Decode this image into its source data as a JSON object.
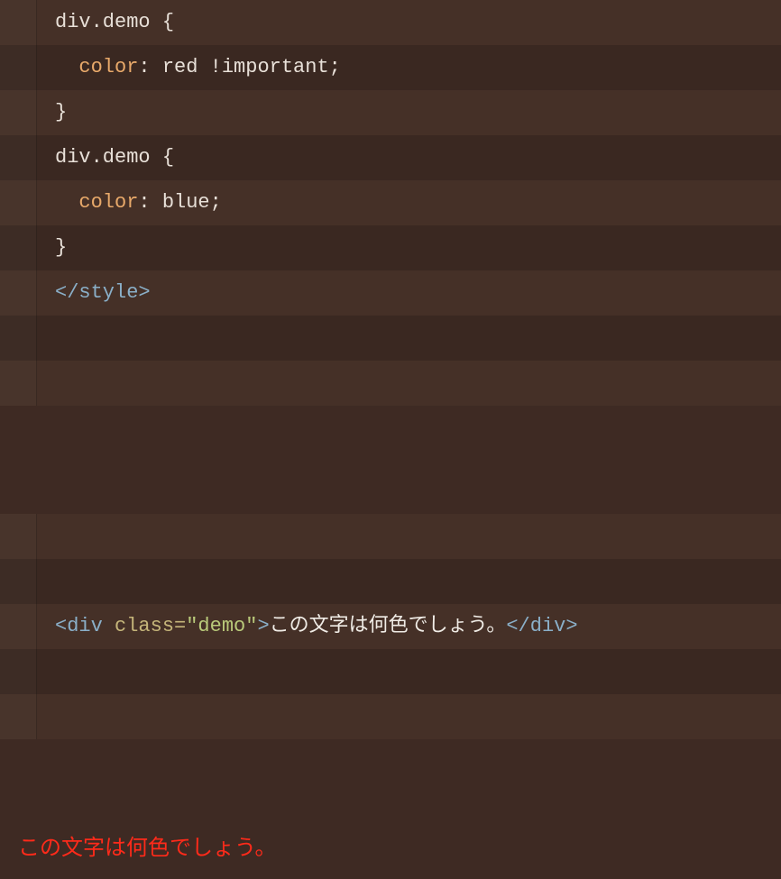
{
  "block1": {
    "lines": [
      {
        "tokens": [
          {
            "t": "div.demo {",
            "c": "tok-default"
          }
        ],
        "indent": 0
      },
      {
        "tokens": [
          {
            "t": "color",
            "c": "tok-property"
          },
          {
            "t": ": red !important;",
            "c": "tok-default"
          }
        ],
        "indent": 1
      },
      {
        "tokens": [
          {
            "t": "}",
            "c": "tok-default"
          }
        ],
        "indent": 0
      },
      {
        "tokens": [
          {
            "t": "div.demo {",
            "c": "tok-default"
          }
        ],
        "indent": 0
      },
      {
        "tokens": [
          {
            "t": "color",
            "c": "tok-property"
          },
          {
            "t": ": blue;",
            "c": "tok-default"
          }
        ],
        "indent": 1
      },
      {
        "tokens": [
          {
            "t": "}",
            "c": "tok-default"
          }
        ],
        "indent": 0
      },
      {
        "tokens": [
          {
            "t": "</style>",
            "c": "tok-tag"
          }
        ],
        "indent": 0
      },
      {
        "tokens": [],
        "indent": 0
      },
      {
        "tokens": [],
        "indent": 0
      }
    ]
  },
  "block2": {
    "lines": [
      {
        "tokens": [],
        "indent": 0
      },
      {
        "tokens": [],
        "indent": 0
      },
      {
        "tokens": [
          {
            "t": "<div ",
            "c": "tok-tag"
          },
          {
            "t": "class=",
            "c": "tok-attr"
          },
          {
            "t": "\"demo\"",
            "c": "tok-string"
          },
          {
            "t": ">",
            "c": "tok-tag"
          },
          {
            "t": "この文字は何色でしょう。",
            "c": "tok-text"
          },
          {
            "t": "</div>",
            "c": "tok-tag"
          }
        ],
        "indent": 0
      },
      {
        "tokens": [],
        "indent": 0
      },
      {
        "tokens": [],
        "indent": 0
      }
    ]
  },
  "output": {
    "text": "この文字は何色でしょう。",
    "color": "#ff2a1a"
  }
}
